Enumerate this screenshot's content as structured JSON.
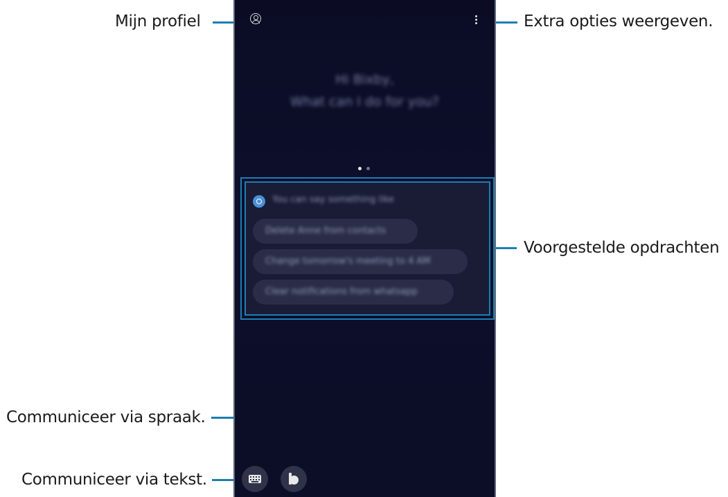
{
  "callouts": {
    "profile": "Mijn profiel",
    "more_options": "Extra opties weergeven.",
    "suggested_commands": "Voorgestelde opdrachten",
    "voice": "Communiceer via spraak.",
    "text": "Communiceer via tekst."
  },
  "phone": {
    "profile_icon": "profile-icon",
    "more_icon": "more-options-icon",
    "greeting_line1": "Hi Bixby,",
    "greeting_line2": "What can I do for you?",
    "page_indicator": {
      "count": 2,
      "active": 1
    },
    "suggestions": {
      "header": "You can say something like",
      "items": [
        "Delete Anne from contacts",
        "Change tomorrow's meeting to 4 AM",
        "Clear notifications from whatsapp"
      ]
    },
    "keyboard_button_icon": "keyboard-icon",
    "voice_button_icon": "bixby-icon"
  },
  "colors": {
    "callout_line": "#1c7fb3",
    "screen_bg": "#0c0d26",
    "chip_bg": "#2b2d48"
  }
}
